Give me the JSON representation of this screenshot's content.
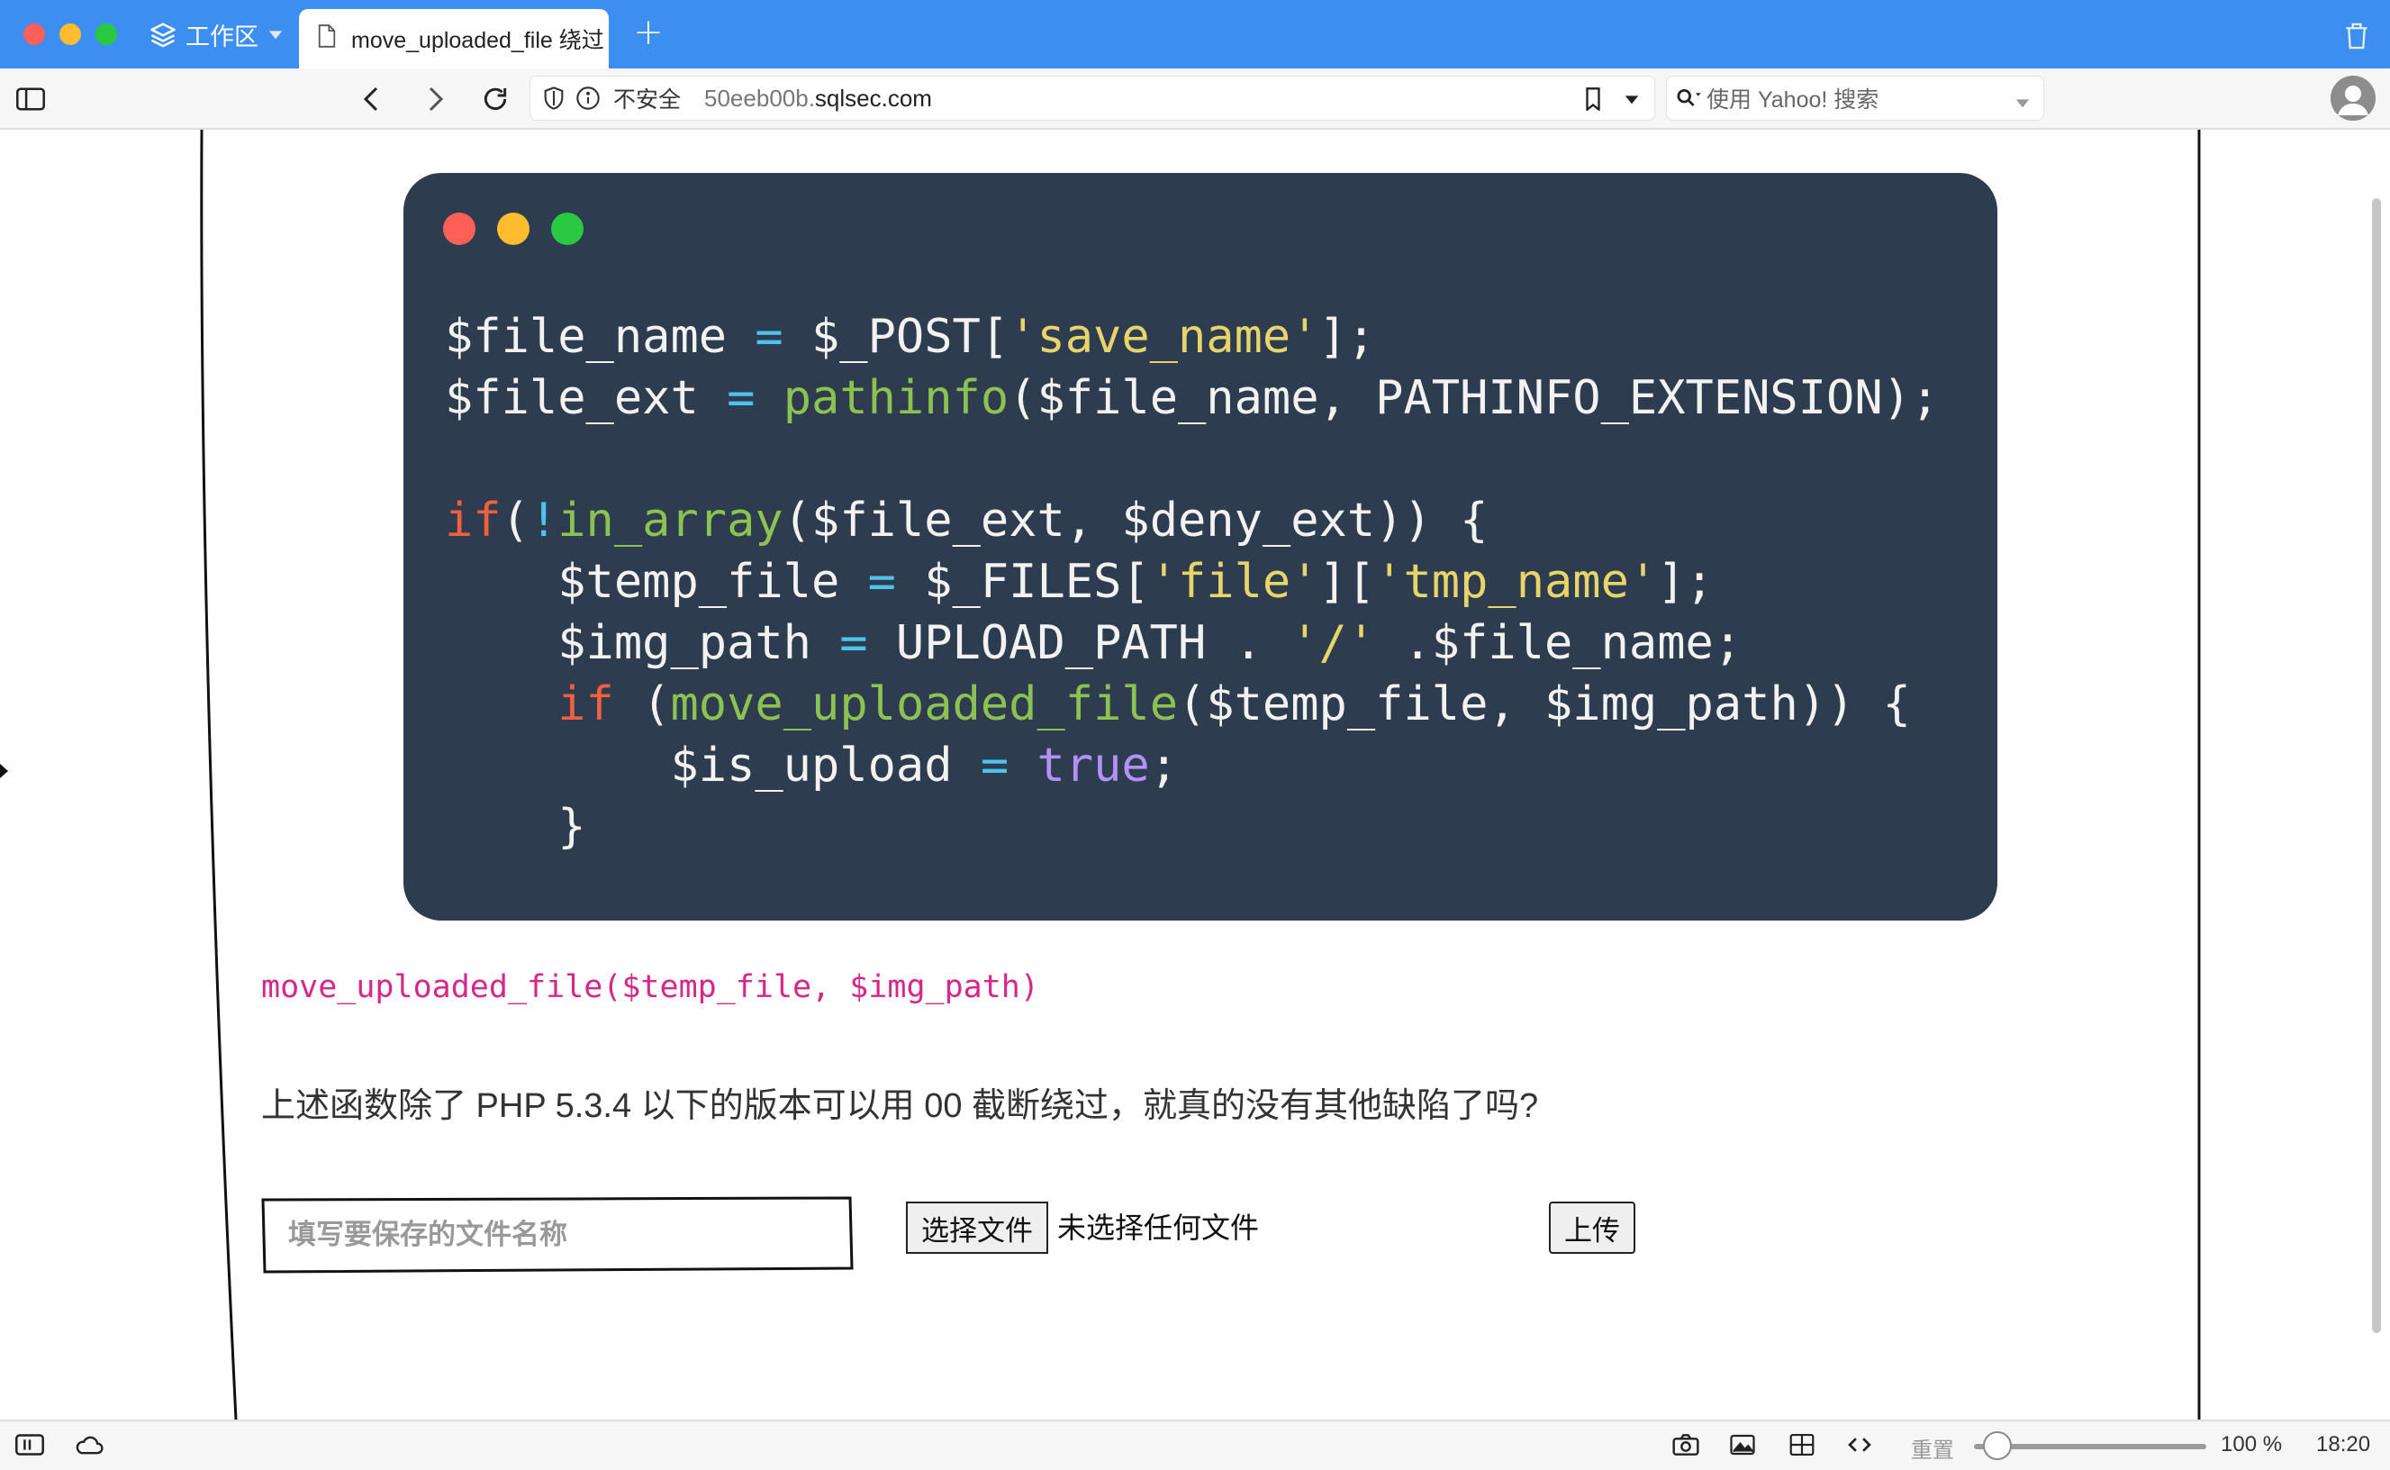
{
  "browser": {
    "workspace_label": "工作区",
    "tab_title": "move_uploaded_file 绕过",
    "new_tab_glyph": "+",
    "address": {
      "insecure_label": "不安全",
      "url_prefix": "50eeb00b.",
      "url_domain": "sqlsec.com"
    },
    "search_placeholder": "使用 Yahoo! 搜索"
  },
  "code_block": {
    "language": "php",
    "lines": [
      "$file_name = $_POST['save_name'];",
      "$file_ext = pathinfo($file_name, PATHINFO_EXTENSION);",
      "",
      "if(!in_array($file_ext, $deny_ext)) {",
      "    $temp_file = $_FILES['file']['tmp_name'];",
      "    $img_path = UPLOAD_PATH . '/' .$file_name;",
      "    if (move_uploaded_file($temp_file, $img_path)) {",
      "        $is_upload = true;",
      "    }"
    ]
  },
  "article": {
    "function_signature": "move_uploaded_file($temp_file, $img_path)",
    "question": "上述函数除了 PHP 5.3.4 以下的版本可以用 00 截断绕过，就真的没有其他缺陷了吗?"
  },
  "upload_form": {
    "name_placeholder": "填写要保存的文件名称",
    "choose_file_label": "选择文件",
    "file_status": "未选择任何文件",
    "submit_label": "上传"
  },
  "statusbar": {
    "reset_label": "重置",
    "zoom_level": "100 %",
    "zoom_fraction": 0.1,
    "clock": "18:20"
  },
  "colors": {
    "titlebar": "#3c8ef0",
    "code_background": "#2d3c4e",
    "keyword": "#f1603e",
    "function": "#8dc151",
    "string": "#e8d56a",
    "operator": "#4fc2ee",
    "boolean": "#b292f5",
    "inline_code": "#d6278a"
  }
}
